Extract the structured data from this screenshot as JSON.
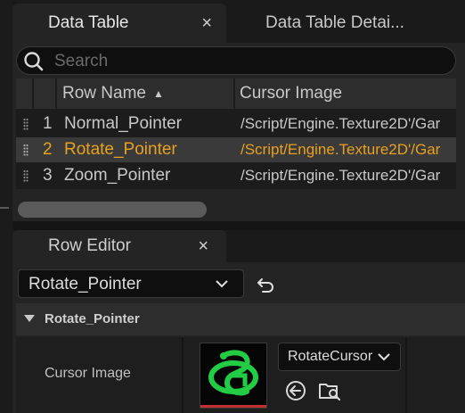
{
  "tabs": {
    "data_table": "Data Table",
    "data_table_details": "Data Table Detai...",
    "close_symbol": "×"
  },
  "search": {
    "placeholder": "Search"
  },
  "table": {
    "columns": [
      "Row Name",
      "Cursor Image"
    ],
    "sort_indicator": "▲",
    "rows": [
      {
        "index": "1",
        "name": "Normal_Pointer",
        "path": "/Script/Engine.Texture2D'/Gar",
        "selected": false
      },
      {
        "index": "2",
        "name": "Rotate_Pointer",
        "path": "/Script/Engine.Texture2D'/Gar",
        "selected": true
      },
      {
        "index": "3",
        "name": "Zoom_Pointer",
        "path": "/Script/Engine.Texture2D'/Gar",
        "selected": false
      }
    ]
  },
  "row_editor": {
    "tab_label": "Row Editor",
    "selected_row": "Rotate_Pointer",
    "section_title": "Rotate_Pointer",
    "property_label": "Cursor Image",
    "asset_value": "RotateCursor"
  },
  "colors": {
    "selected_text": "#e8a020",
    "thumbnail_green": "#22cc44",
    "accent_red": "#c03030"
  },
  "icons": [
    "search-icon",
    "close-icon",
    "grip-icon",
    "chevron-down-icon",
    "undo-icon",
    "collapse-triangle-icon",
    "use-selected-icon",
    "browse-asset-icon"
  ]
}
